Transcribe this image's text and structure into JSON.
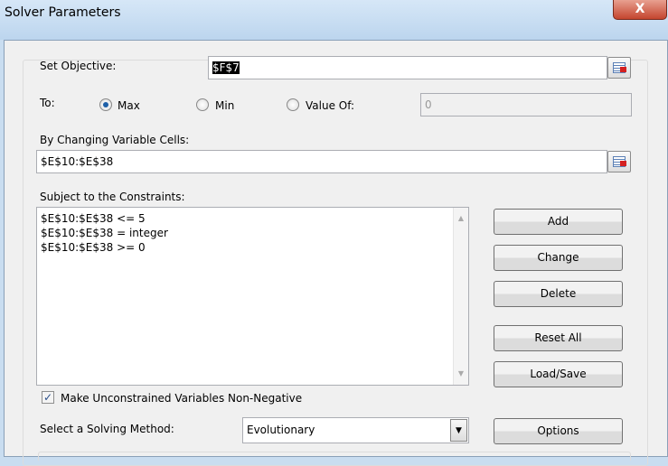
{
  "window": {
    "title": "Solver Parameters",
    "close_label": "X"
  },
  "objective": {
    "label": "Set Objective:",
    "value": "$F$7"
  },
  "to": {
    "label": "To:",
    "options": [
      {
        "label": "Max",
        "selected": true
      },
      {
        "label": "Min",
        "selected": false
      },
      {
        "label": "Value Of:",
        "selected": false
      }
    ],
    "value_of": "0"
  },
  "variables": {
    "label": "By Changing Variable Cells:",
    "value": "$E$10:$E$38"
  },
  "constraints": {
    "label": "Subject to the Constraints:",
    "items": [
      "$E$10:$E$38 <= 5",
      "$E$10:$E$38 = integer",
      "$E$10:$E$38 >= 0"
    ]
  },
  "buttons": {
    "add": "Add",
    "change": "Change",
    "delete": "Delete",
    "reset": "Reset All",
    "load_save": "Load/Save",
    "options": "Options"
  },
  "nonneg": {
    "label": "Make Unconstrained Variables Non-Negative",
    "checked": true
  },
  "method": {
    "label": "Select a Solving Method:",
    "value": "Evolutionary"
  }
}
